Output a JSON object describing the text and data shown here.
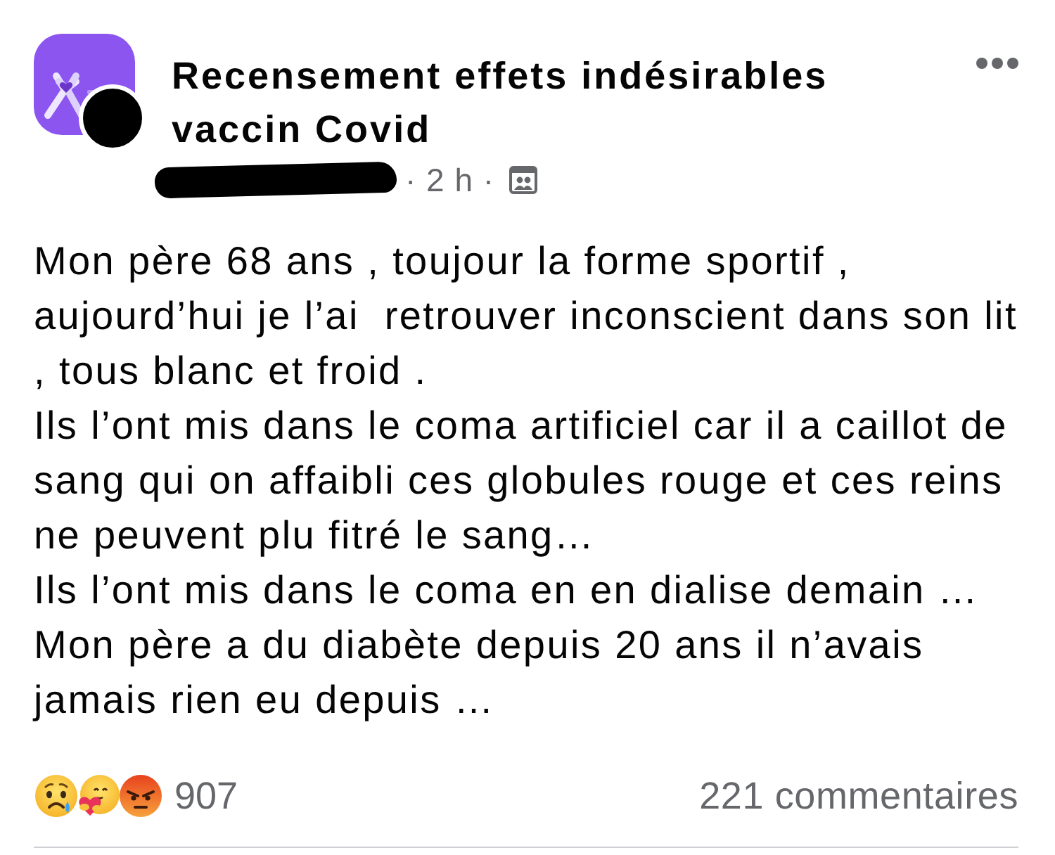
{
  "group": {
    "name": "Recensement effets indésirables vaccin Covid"
  },
  "post": {
    "time": "· 2 h ·",
    "paragraphs": [
      "Mon père 68 ans , toujour la forme sportif , aujourd’hui je l’ai  retrouver inconscient dans son lit , tous blanc et froid .",
      "Ils l’ont mis dans le coma artificiel car il a caillot de sang qui on affaibli ces globules rouge et ces reins ne peuvent plu fitré le sang…",
      "Ils l’ont mis dans le coma en en dialise demain …",
      "Mon père a du diabète depuis 20 ans il n’avais jamais rien eu depuis …"
    ]
  },
  "footer": {
    "reaction_count": "907",
    "comments": "221 commentaires"
  }
}
